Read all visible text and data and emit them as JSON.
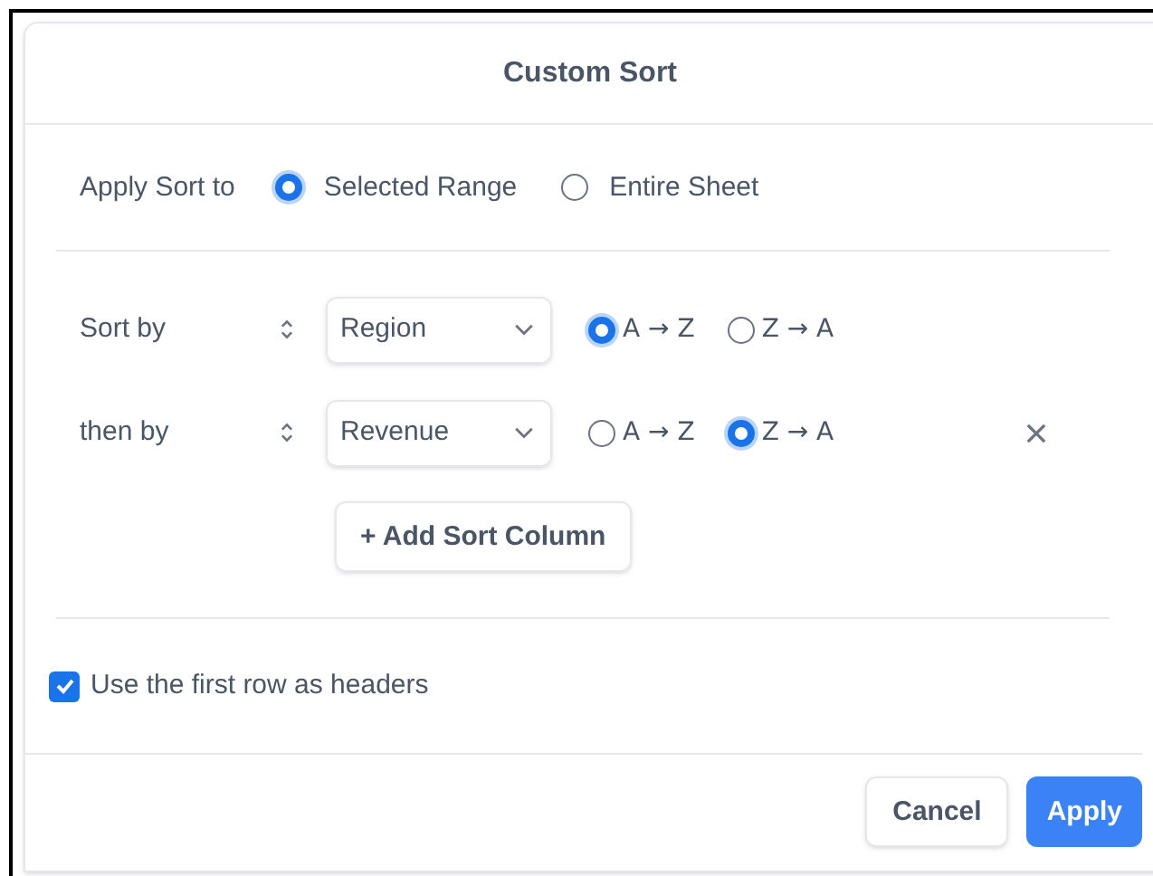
{
  "dialog": {
    "title": "Custom Sort"
  },
  "apply_sort_to": {
    "label": "Apply Sort to",
    "options": [
      {
        "label": "Selected Range",
        "selected": true
      },
      {
        "label": "Entire Sheet",
        "selected": false
      }
    ]
  },
  "sort_rows": [
    {
      "label": "Sort by",
      "column": "Region",
      "removable": false,
      "orders": [
        {
          "label": "A → Z",
          "selected": true
        },
        {
          "label": "Z → A",
          "selected": false
        }
      ]
    },
    {
      "label": "then by",
      "column": "Revenue",
      "removable": true,
      "orders": [
        {
          "label": "A → Z",
          "selected": false
        },
        {
          "label": "Z → A",
          "selected": true
        }
      ]
    }
  ],
  "add_button": "+ Add Sort Column",
  "headers_option": {
    "label": "Use the first row as headers",
    "checked": true
  },
  "buttons": [
    {
      "label": "Cancel",
      "kind": "secondary"
    },
    {
      "label": "Apply",
      "kind": "primary"
    }
  ]
}
